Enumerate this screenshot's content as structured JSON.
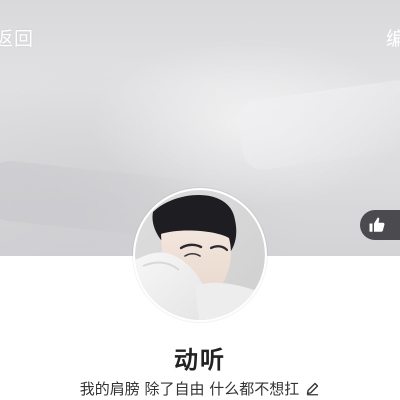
{
  "header": {
    "back_label": "返回",
    "right_label": "编辑"
  },
  "cover": {
    "like_icon": "thumbs-up-icon",
    "like_count": ""
  },
  "profile": {
    "nickname": "动听",
    "signature": "我的肩膀 除了自由 什么都不想扛",
    "signature_edit_icon": "pencil-icon"
  },
  "colors": {
    "cover_gray": "#dcdcde",
    "like_pill": "#4a4a4f",
    "text_dark": "#222222",
    "white": "#ffffff"
  }
}
